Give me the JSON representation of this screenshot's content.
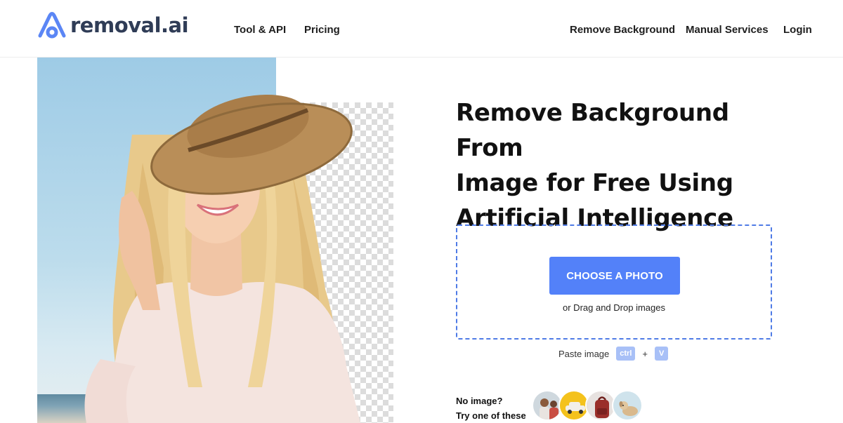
{
  "header": {
    "logo_text": "removal.ai",
    "nav_left": [
      "Tool & API",
      "Pricing"
    ],
    "nav_right": [
      "Remove Background",
      "Manual Services",
      "Login"
    ]
  },
  "hero": {
    "headline_lines": [
      "Remove Background From",
      "Image for Free Using",
      "Artificial Intelligence"
    ]
  },
  "upload": {
    "button_label": "CHOOSE A PHOTO",
    "drag_text": "or Drag and Drop images",
    "paste_label": "Paste image",
    "key_ctrl": "ctrl",
    "key_plus": "+",
    "key_v": "V"
  },
  "samples": {
    "line1": "No image?",
    "line2": "Try one of these",
    "items": [
      "sample-people",
      "sample-car",
      "sample-backpack",
      "sample-dog"
    ]
  },
  "colors": {
    "accent": "#5381f9",
    "dashed_border": "#4f7be6",
    "logo_text": "#2f3c56",
    "logo_mark": "#5b86f5"
  }
}
